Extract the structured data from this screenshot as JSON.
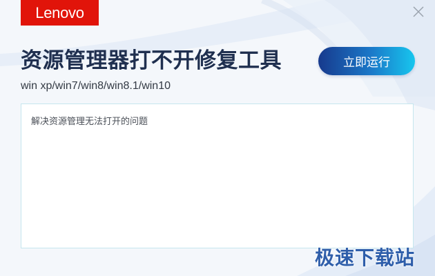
{
  "window": {
    "logo_text": "Lenovo",
    "title": "资源管理器打不开修复工具",
    "subtitle": "win xp/win7/win8/win8.1/win10",
    "run_button_label": "立即运行",
    "description": "解决资源管理无法打开的问题",
    "close_icon": "close-icon"
  },
  "watermark": {
    "text": "极速下载站"
  },
  "colors": {
    "brand_red": "#e1140a",
    "title_navy": "#1f2f4f",
    "button_start": "#173a8d",
    "button_end": "#17c6ee",
    "background": "#f4f7fb",
    "box_border": "#c5e6ee"
  }
}
